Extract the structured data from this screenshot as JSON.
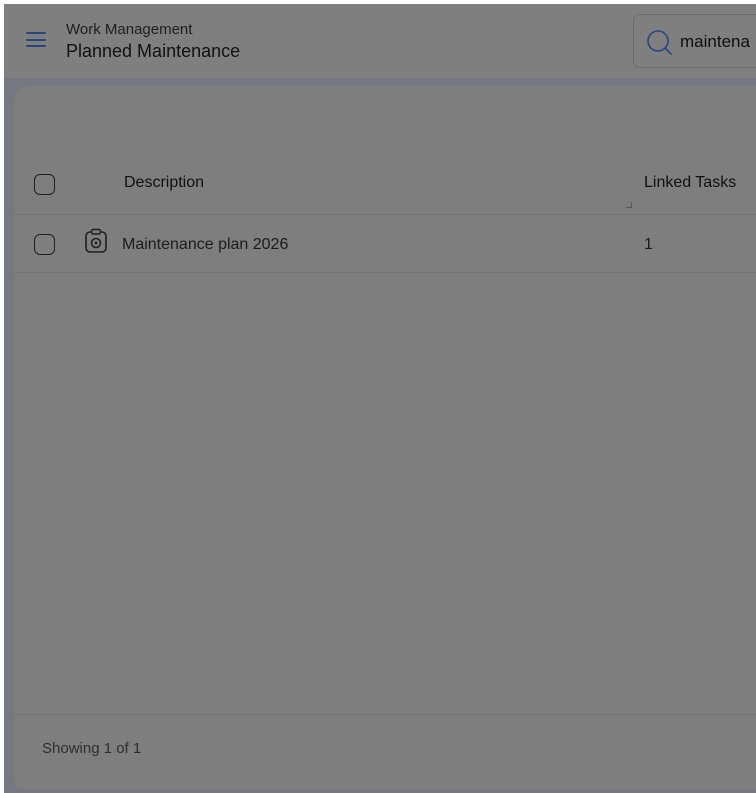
{
  "header": {
    "menu_icon": "hamburger-menu-icon",
    "breadcrumb": "Work Management",
    "title": "Planned Maintenance",
    "search": {
      "icon": "search-icon",
      "value": "maintena"
    }
  },
  "table": {
    "columns": [
      {
        "label": "Description"
      },
      {
        "label": "Linked Tasks"
      }
    ],
    "rows": [
      {
        "icon": "maintenance-clipboard-icon",
        "description": "Maintenance plan 2026",
        "linked_tasks": "1"
      }
    ]
  },
  "footer": {
    "showing": "Showing 1 of 1"
  },
  "colors": {
    "accent": "#28467e",
    "overlay_bg": "#7f7f7f"
  }
}
